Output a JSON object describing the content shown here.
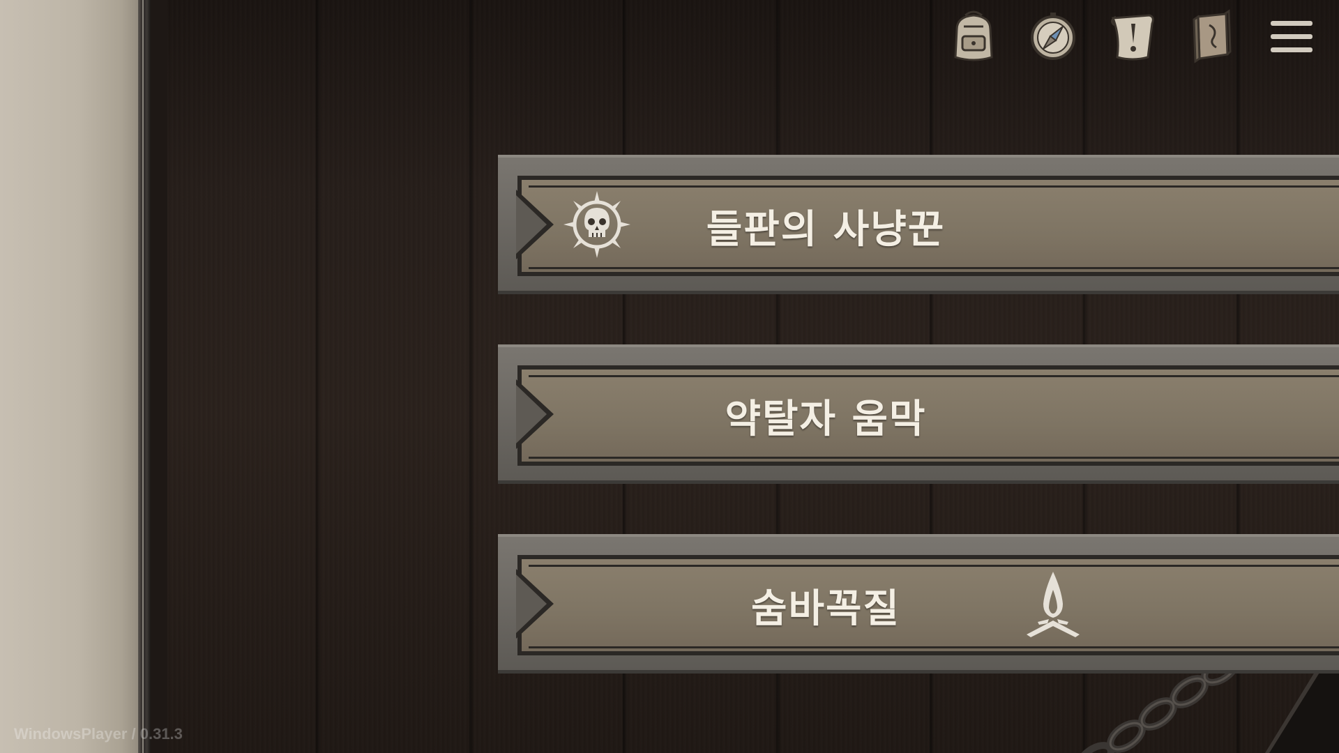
{
  "version_text": "WindowsPlayer / 0.31.3",
  "toolbar": {
    "icons": [
      {
        "name": "backpack-icon"
      },
      {
        "name": "compass-icon"
      },
      {
        "name": "quest-scroll-icon"
      },
      {
        "name": "journal-icon"
      },
      {
        "name": "menu-icon"
      }
    ]
  },
  "menu": {
    "items": [
      {
        "label": "들판의 사냥꾼",
        "icon_left": "skull-sun-icon"
      },
      {
        "label": "약탈자 움막"
      },
      {
        "label": "숨바꼭질",
        "icon_right": "campfire-icon"
      }
    ]
  },
  "colors": {
    "banner_face": "#857a68",
    "banner_border": "#2b2825",
    "label_text": "#f4efe4",
    "parchment": "#c2baad",
    "wood": "#261e1a"
  }
}
